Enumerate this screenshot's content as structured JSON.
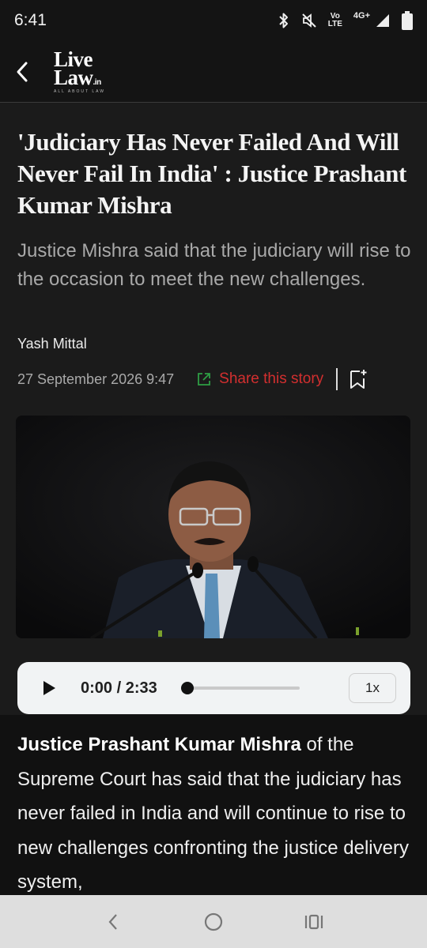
{
  "status_bar": {
    "time": "6:41",
    "volte_top": "Vo",
    "volte_bottom": "LTE",
    "network": "4G+"
  },
  "header": {
    "logo_line1": "Live",
    "logo_line2": "Law",
    "logo_suffix": ".in",
    "logo_tagline": "ALL ABOUT LAW"
  },
  "article": {
    "title": "'Judiciary Has Never Failed And Will Never Fail In India' : Justice Prashant Kumar Mishra",
    "summary": "Justice Mishra said that the judiciary will rise to the occasion to meet the new challenges.",
    "author": "Yash Mittal",
    "date": "27 September 2026 9:47",
    "share_label": "Share this story",
    "body_lead": "Justice Prashant Kumar Mishra",
    "body_rest": " of the Supreme Court has said that the judiciary has never failed in India and will continue to rise to new challenges confronting the justice delivery system,"
  },
  "audio": {
    "time": "0:00 / 2:33",
    "progress": 0,
    "speed": "1x"
  },
  "colors": {
    "accent_red": "#d32f2f",
    "share_icon_green": "#2e9e44",
    "background": "#1b1b1b"
  },
  "icons": {
    "back": "chevron-left-icon",
    "bluetooth": "bluetooth-icon",
    "mute": "mute-icon",
    "signal": "signal-icon",
    "battery": "battery-icon",
    "share": "share-external-icon",
    "bookmark": "bookmark-add-icon",
    "play": "play-icon",
    "nav_back": "nav-back-icon",
    "nav_home": "nav-home-icon",
    "nav_recents": "nav-recents-icon"
  }
}
